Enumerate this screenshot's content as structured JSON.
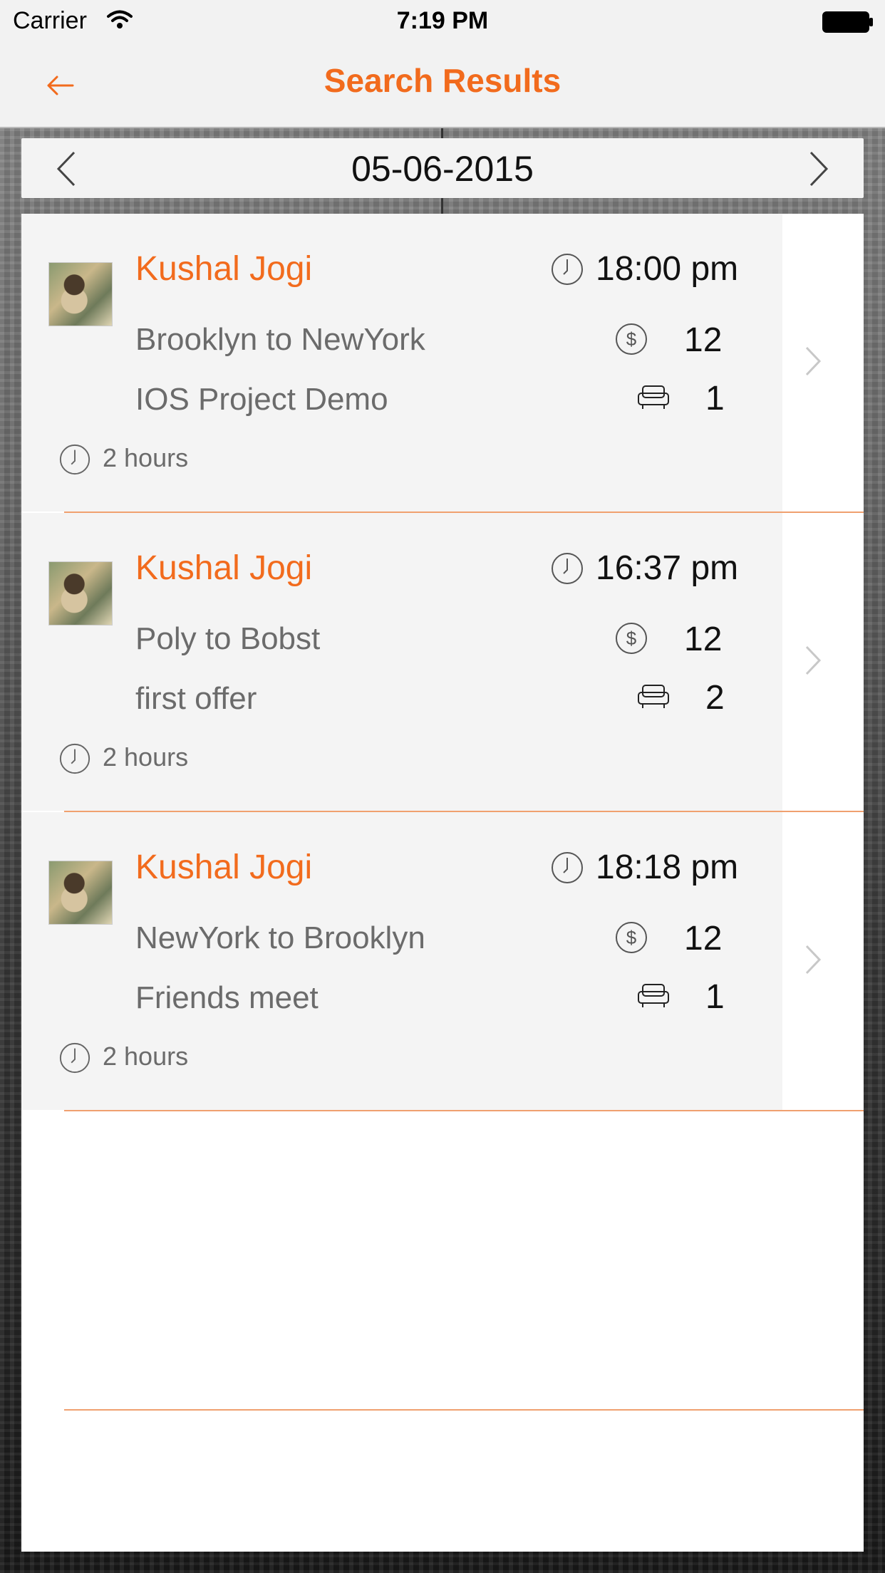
{
  "status_bar": {
    "carrier": "Carrier",
    "time": "7:19 PM"
  },
  "nav": {
    "title": "Search Results",
    "back_icon": "arrow-left-icon"
  },
  "date_bar": {
    "date": "05-06-2015",
    "prev_icon": "chevron-left-icon",
    "next_icon": "chevron-right-icon"
  },
  "colors": {
    "accent": "#f26b1d",
    "separator": "#f0a06f",
    "card": "#f4f4f4"
  },
  "results": [
    {
      "name": "Kushal Jogi",
      "time": "18:00  pm",
      "route": "Brooklyn to NewYork",
      "description": "IOS Project Demo",
      "price": "12",
      "seats": "1",
      "duration": "2 hours"
    },
    {
      "name": "Kushal Jogi",
      "time": "16:37  pm",
      "route": "Poly to Bobst",
      "description": "first offer",
      "price": "12",
      "seats": "2",
      "duration": "2 hours"
    },
    {
      "name": "Kushal Jogi",
      "time": "18:18  pm",
      "route": "NewYork to Brooklyn",
      "description": "Friends meet",
      "price": "12",
      "seats": "1",
      "duration": "2 hours"
    }
  ]
}
